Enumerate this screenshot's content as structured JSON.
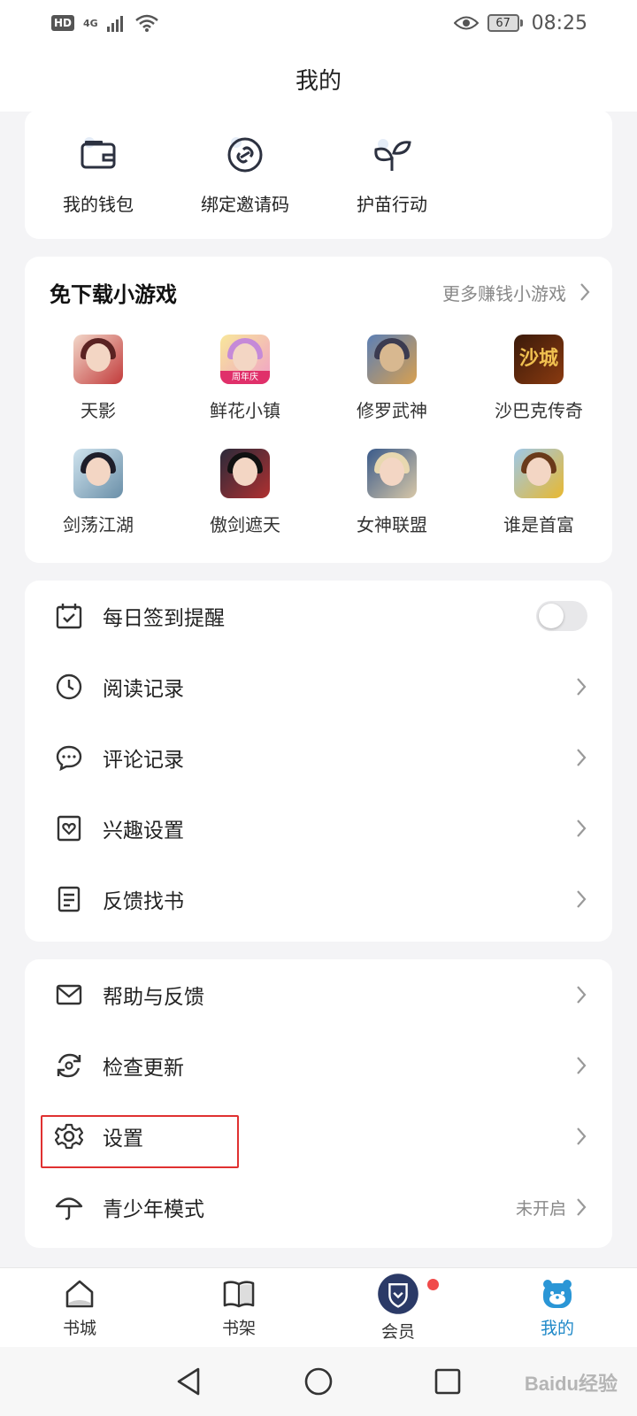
{
  "status_bar": {
    "hd": "HD",
    "network": "4G",
    "battery": "67",
    "time": "08:25"
  },
  "header": {
    "title": "我的"
  },
  "shortcuts": [
    {
      "label": "我的钱包",
      "icon": "wallet-icon"
    },
    {
      "label": "绑定邀请码",
      "icon": "link-icon"
    },
    {
      "label": "护苗行动",
      "icon": "sprout-icon"
    }
  ],
  "games": {
    "title": "免下载小游戏",
    "more": "更多赚钱小游戏",
    "items": [
      {
        "label": "天影"
      },
      {
        "label": "鲜花小镇",
        "badge": "周年庆"
      },
      {
        "label": "修罗武神"
      },
      {
        "label": "沙巴克传奇",
        "glyph": "沙城"
      },
      {
        "label": "剑荡江湖"
      },
      {
        "label": "傲剑遮天"
      },
      {
        "label": "女神联盟"
      },
      {
        "label": "谁是首富"
      }
    ]
  },
  "menu_group1": [
    {
      "label": "每日签到提醒",
      "icon": "calendar-check-icon",
      "toggle": false
    },
    {
      "label": "阅读记录",
      "icon": "clock-icon"
    },
    {
      "label": "评论记录",
      "icon": "chat-bubble-icon"
    },
    {
      "label": "兴趣设置",
      "icon": "heart-frame-icon"
    },
    {
      "label": "反馈找书",
      "icon": "document-icon"
    }
  ],
  "menu_group2": [
    {
      "label": "帮助与反馈",
      "icon": "mail-icon"
    },
    {
      "label": "检查更新",
      "icon": "refresh-icon"
    },
    {
      "label": "设置",
      "icon": "gear-icon"
    },
    {
      "label": "青少年模式",
      "icon": "umbrella-icon",
      "value": "未开启"
    }
  ],
  "bottom_nav": [
    {
      "label": "书城",
      "icon": "house-icon"
    },
    {
      "label": "书架",
      "icon": "book-icon"
    },
    {
      "label": "会员",
      "icon": "vip-shield-icon"
    },
    {
      "label": "我的",
      "icon": "bear-face-icon",
      "active": true
    }
  ],
  "watermark": "Baidu经验",
  "colors": {
    "accent": "#1e88c8",
    "highlight": "#e03131",
    "badge": "#f04a4a"
  }
}
